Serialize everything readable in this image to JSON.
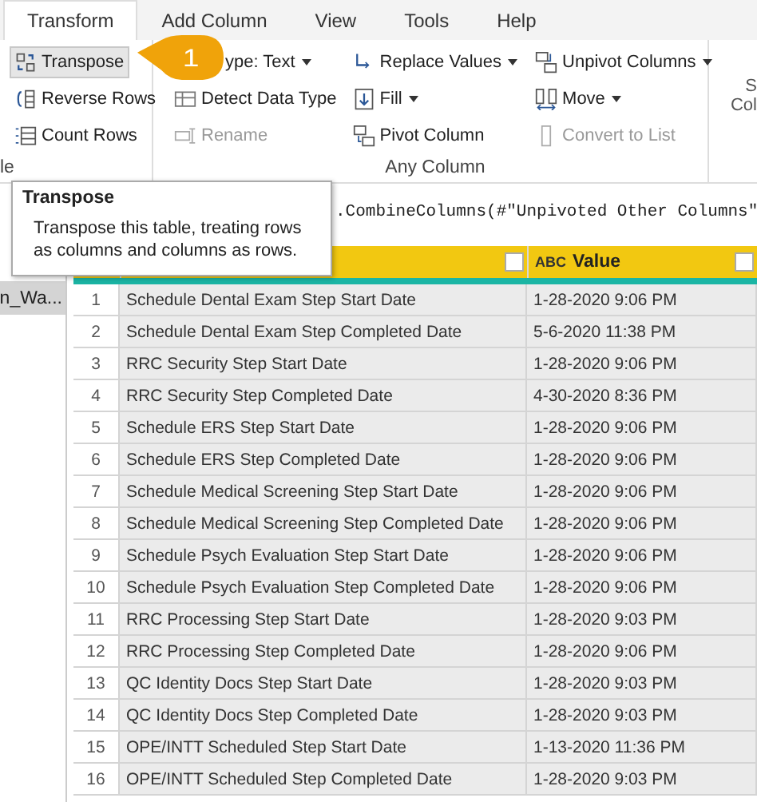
{
  "tabs": [
    {
      "label": "Transform",
      "selected": true
    },
    {
      "label": "Add Column",
      "selected": false
    },
    {
      "label": "View",
      "selected": false
    },
    {
      "label": "Tools",
      "selected": false
    },
    {
      "label": "Help",
      "selected": false
    }
  ],
  "ribbon": {
    "groups": [
      {
        "label": "le",
        "columns": [
          [
            {
              "label": "Transpose",
              "highlighted": true,
              "disabled": false,
              "dropdown": false
            },
            {
              "label": "Reverse Rows",
              "highlighted": false,
              "disabled": false,
              "dropdown": false
            },
            {
              "label": "Count Rows",
              "highlighted": false,
              "disabled": false,
              "dropdown": false
            }
          ]
        ]
      },
      {
        "label": "Any Column",
        "columns": [
          [
            {
              "label": "ype: Text",
              "highlighted": false,
              "disabled": false,
              "dropdown": true
            },
            {
              "label": "Detect Data Type",
              "highlighted": false,
              "disabled": false,
              "dropdown": false
            },
            {
              "label": "Rename",
              "highlighted": false,
              "disabled": true,
              "dropdown": false
            }
          ],
          [
            {
              "label": "Replace Values",
              "highlighted": false,
              "disabled": false,
              "dropdown": true
            },
            {
              "label": "Fill",
              "highlighted": false,
              "disabled": false,
              "dropdown": true
            },
            {
              "label": "Pivot Column",
              "highlighted": false,
              "disabled": false,
              "dropdown": false
            }
          ],
          [
            {
              "label": "Unpivot Columns",
              "highlighted": false,
              "disabled": false,
              "dropdown": true
            },
            {
              "label": "Move",
              "highlighted": false,
              "disabled": false,
              "dropdown": true
            },
            {
              "label": "Convert to List",
              "highlighted": false,
              "disabled": true,
              "dropdown": false
            }
          ]
        ]
      }
    ],
    "cut_group": [
      "S",
      "Col"
    ]
  },
  "callout": {
    "label": "1"
  },
  "tooltip": {
    "title": "Transpose",
    "description": "Transpose this table, treating rows as columns and columns as rows."
  },
  "formula": ".CombineColumns(#\"Unpivoted Other Columns\"",
  "queries": [
    {
      "label": "n_Wa...",
      "selected": true
    }
  ],
  "table": {
    "columns": [
      {},
      {
        "label": "Value",
        "type": "ABC"
      }
    ],
    "rows": [
      {
        "index": "1",
        "cells": [
          "Schedule Dental Exam Step Start Date",
          "1-28-2020 9:06 PM"
        ]
      },
      {
        "index": "2",
        "cells": [
          "Schedule Dental Exam Step Completed Date",
          "5-6-2020 11:38 PM"
        ]
      },
      {
        "index": "3",
        "cells": [
          "RRC Security Step Start Date",
          "1-28-2020 9:06 PM"
        ]
      },
      {
        "index": "4",
        "cells": [
          "RRC Security Step Completed Date",
          "4-30-2020 8:36 PM"
        ]
      },
      {
        "index": "5",
        "cells": [
          "Schedule ERS Step Start Date",
          "1-28-2020 9:06 PM"
        ]
      },
      {
        "index": "6",
        "cells": [
          "Schedule ERS Step Completed Date",
          "1-28-2020 9:06 PM"
        ]
      },
      {
        "index": "7",
        "cells": [
          "Schedule Medical Screening Step Start Date",
          "1-28-2020 9:06 PM"
        ]
      },
      {
        "index": "8",
        "cells": [
          "Schedule Medical Screening Step Completed Date",
          "1-28-2020 9:06 PM"
        ]
      },
      {
        "index": "9",
        "cells": [
          "Schedule Psych Evaluation Step Start Date",
          "1-28-2020 9:06 PM"
        ]
      },
      {
        "index": "10",
        "cells": [
          "Schedule Psych Evaluation Step Completed Date",
          "1-28-2020 9:06 PM"
        ]
      },
      {
        "index": "11",
        "cells": [
          "RRC Processing Step Start Date",
          "1-28-2020 9:03 PM"
        ]
      },
      {
        "index": "12",
        "cells": [
          "RRC Processing Step Completed Date",
          "1-28-2020 9:06 PM"
        ]
      },
      {
        "index": "13",
        "cells": [
          "QC Identity Docs Step Start Date",
          "1-28-2020 9:03 PM"
        ]
      },
      {
        "index": "14",
        "cells": [
          "QC Identity Docs Step Completed Date",
          "1-28-2020 9:03 PM"
        ]
      },
      {
        "index": "15",
        "cells": [
          "OPE/INTT Scheduled Step Start Date",
          "1-13-2020 11:36 PM"
        ]
      },
      {
        "index": "16",
        "cells": [
          "OPE/INTT Scheduled Step Completed Date",
          "1-28-2020 9:03 PM"
        ]
      }
    ]
  }
}
